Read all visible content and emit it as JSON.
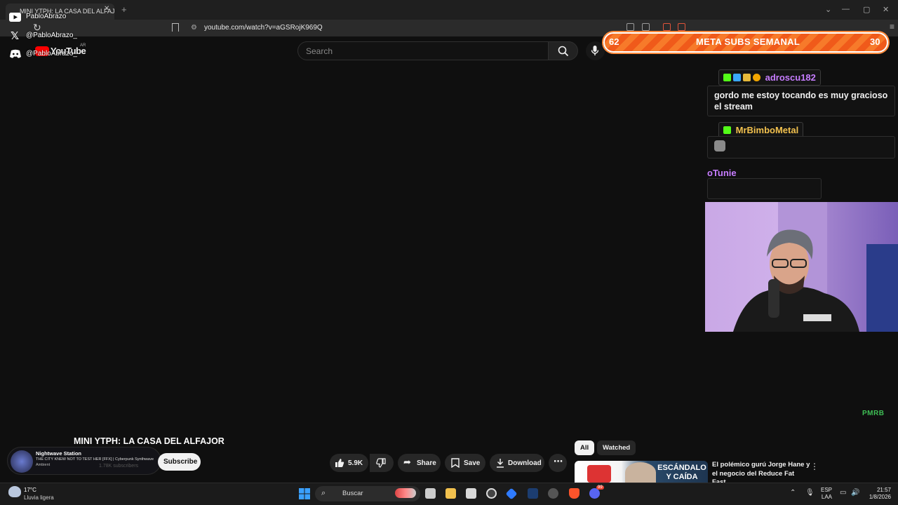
{
  "browser": {
    "tab_title": "MINI YTPH: LA CASA DEL ALFAJOR",
    "url": "youtube.com/watch?v=aGSRojK969Q"
  },
  "youtube": {
    "search_placeholder": "Search",
    "logo_text": "YouTube",
    "country": "AR"
  },
  "overlay": {
    "socials": [
      {
        "icon": "youtube-icon",
        "label": "PabloAbrazo"
      },
      {
        "icon": "x-icon",
        "label": "@PabloAbrazo_"
      },
      {
        "icon": "discord-icon",
        "label": "@PabloAbrazo_"
      }
    ],
    "meta": {
      "left": "62",
      "title": "META SUBS SEMANAL",
      "right": "30",
      "color": "#f26a1f"
    },
    "chat": [
      {
        "name": "adroscu182",
        "name_color": "#c77dff",
        "message": "gordo me estoy tocando es muy gracioso el stream"
      },
      {
        "name": "MrBimboMetal",
        "name_color": "#f2c14e",
        "message": ""
      },
      {
        "name": "oTunie",
        "name_color": "#c77dff",
        "message": ""
      }
    ],
    "watermark": "PMRB"
  },
  "video": {
    "title": "MINI YTPH: LA CASA DEL ALFAJOR",
    "channel_sub_count": "1.78K subscribers",
    "subscribe_label": "Subscribe",
    "likes": "5.9K",
    "share_label": "Share",
    "save_label": "Save",
    "download_label": "Download"
  },
  "now_playing": {
    "station": "Nightwave Station",
    "track": "THE CITY KNEW NOT TO TEST HER [FFX] | Cyberpunk Synthwave",
    "genre": "Ambient"
  },
  "sidebar": {
    "chips": [
      "All",
      "Watched"
    ],
    "thumb_text": "ESCÁNDALO Y CAÍDA",
    "rec_title": "El polémico gurú Jorge Hane y el negocio del Reduce Fat Fast..."
  },
  "taskbar": {
    "weather_temp": "17°C",
    "weather_desc": "Lluvia ligera",
    "search_label": "Buscar",
    "lang": "ESP",
    "lang2": "LAA",
    "time": "21:57",
    "date": "1/8/2026",
    "discord_badge": "99"
  }
}
